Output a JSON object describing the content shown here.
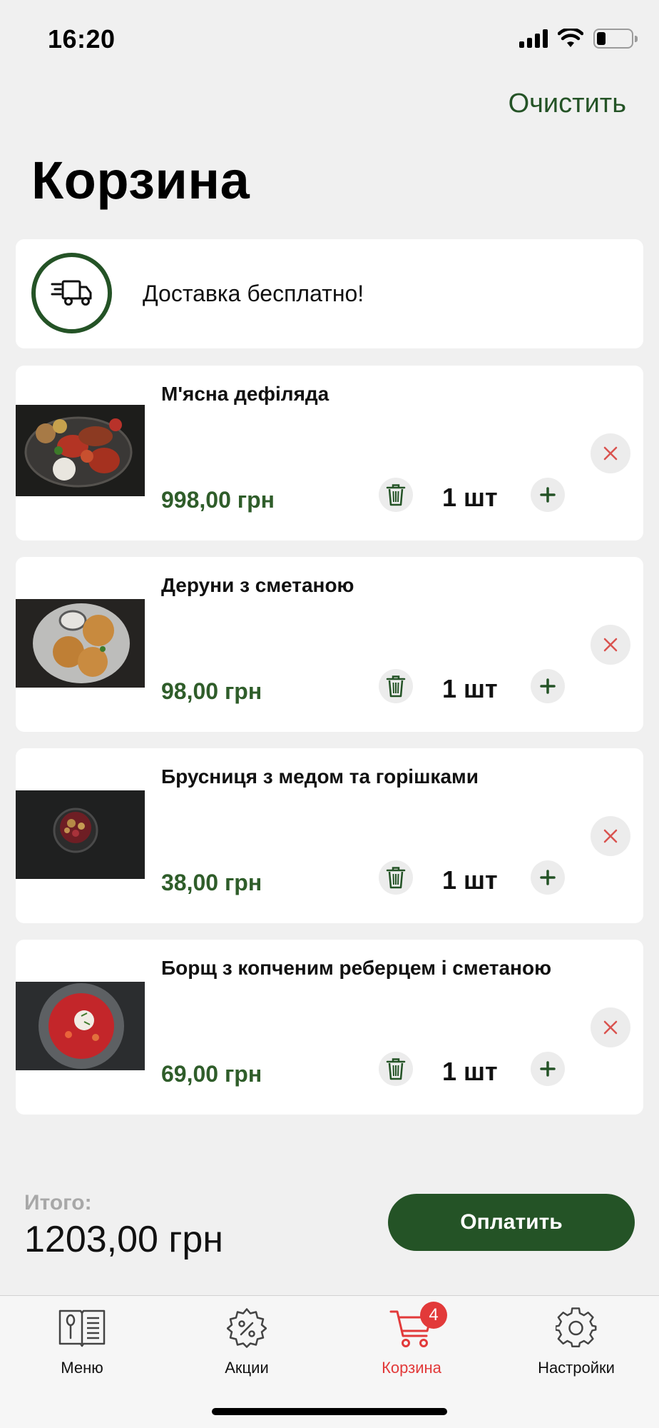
{
  "status_bar": {
    "time": "16:20",
    "battery_level": 0.25
  },
  "header": {
    "clear_label": "Очистить",
    "title": "Корзина"
  },
  "delivery": {
    "text": "Доставка бесплатно!",
    "icon": "delivery-truck-icon"
  },
  "items": [
    {
      "name": "М'ясна дефіляда",
      "price": "998,00 грн",
      "qty": "1 шт"
    },
    {
      "name": "Деруни з сметаною",
      "price": "98,00 грн",
      "qty": "1 шт"
    },
    {
      "name": "Брусниця з медом  та горішками",
      "price": "38,00 грн",
      "qty": "1 шт"
    },
    {
      "name": "Борщ з копченим реберцем і сметаною",
      "price": "69,00 грн",
      "qty": "1 шт"
    }
  ],
  "total": {
    "label": "Итого:",
    "value": "1203,00 грн"
  },
  "pay_button": {
    "label": "Оплатить"
  },
  "tabs": [
    {
      "label": "Меню",
      "icon": "menu-book-icon",
      "active": false
    },
    {
      "label": "Акции",
      "icon": "discount-gear-icon",
      "active": false
    },
    {
      "label": "Корзина",
      "icon": "cart-icon",
      "active": true,
      "badge": "4"
    },
    {
      "label": "Настройки",
      "icon": "settings-gear-icon",
      "active": false
    }
  ],
  "colors": {
    "accent": "#245326",
    "price": "#2f5d2a",
    "active_tab": "#e23a3a",
    "remove": "#d9534f"
  }
}
